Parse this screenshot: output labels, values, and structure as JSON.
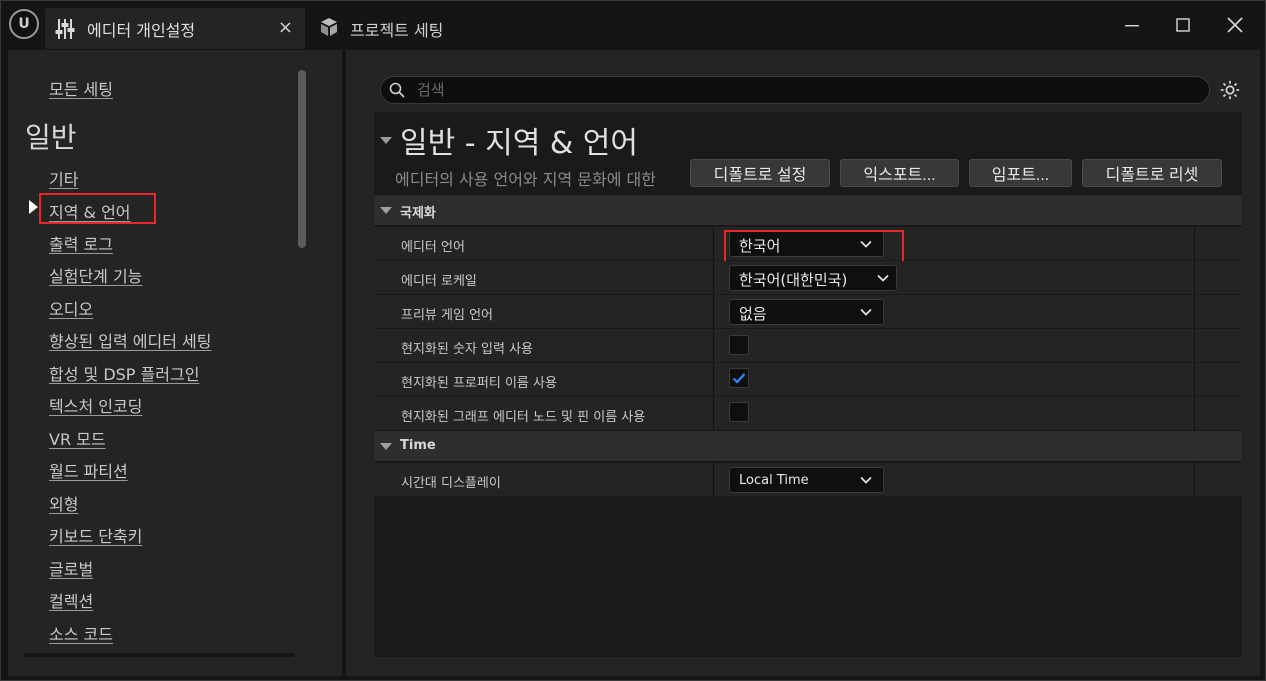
{
  "titlebar": {
    "active_tab": "에디터 개인설정",
    "close_symbol": "×",
    "inactive_tab": "프로젝트 세팅",
    "minimize_symbol": "—",
    "close_window_symbol": "✕"
  },
  "sidebar": {
    "all_settings": "모든 세팅",
    "heading": "일반",
    "items": [
      "기타",
      "지역 & 언어",
      "출력 로그",
      "실험단계 기능",
      "오디오",
      "향상된 입력 에디터 세팅",
      "합성 및 DSP 플러그인",
      "텍스처 인코딩",
      "VR 모드",
      "월드 파티션",
      "외형",
      "키보드 단축키",
      "글로벌",
      "컬렉션",
      "소스 코드"
    ],
    "selected_index": 1
  },
  "search": {
    "placeholder": "검색"
  },
  "section": {
    "title": "일반 - 지역 & 언어",
    "description": "에디터의 사용 언어와 지역 문화에 대한",
    "buttons": [
      "디폴트로 설정",
      "익스포트...",
      "임포트...",
      "디폴트로 리셋"
    ]
  },
  "categories": [
    {
      "label": "국제화",
      "properties": [
        {
          "label": "에디터 언어",
          "type": "combo",
          "value": "한국어"
        },
        {
          "label": "에디터 로케일",
          "type": "combo",
          "value": "한국어(대한민국)"
        },
        {
          "label": "프리뷰 게임 언어",
          "type": "combo",
          "value": "없음"
        },
        {
          "label": "현지화된 숫자 입력 사용",
          "type": "checkbox",
          "checked": false
        },
        {
          "label": "현지화된 프로퍼티 이름 사용",
          "type": "checkbox",
          "checked": true
        },
        {
          "label": "현지화된 그래프 에디터 노드 및 핀 이름 사용",
          "type": "checkbox",
          "checked": false
        }
      ]
    },
    {
      "label": "Time",
      "properties": [
        {
          "label": "시간대 디스플레이",
          "type": "combo",
          "value": "Local Time"
        }
      ]
    }
  ],
  "colors": {
    "highlight": "#e8262b",
    "check": "#2f8bff"
  }
}
